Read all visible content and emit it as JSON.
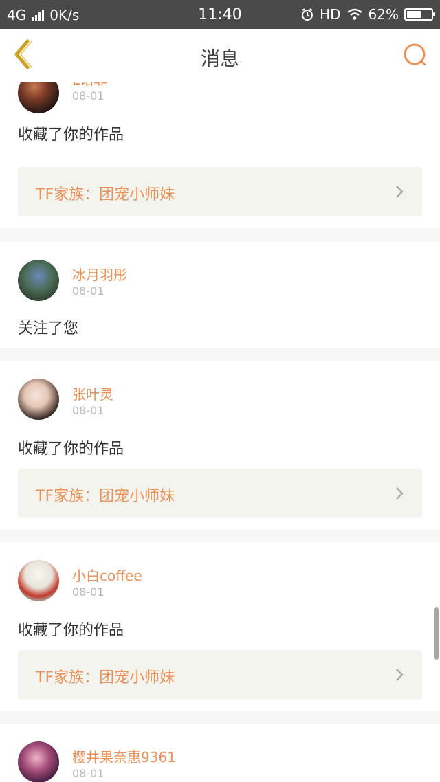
{
  "status": {
    "network": "4G",
    "speed": "0K/s",
    "time": "11:40",
    "hd": "HD",
    "battery": "62%",
    "battery_level": 0.62
  },
  "nav": {
    "title": "消息",
    "back_icon": "chevron-left-icon",
    "search_icon": "search-icon",
    "accent": "#e9925a"
  },
  "messages": [
    {
      "name": "L诺菲",
      "date": "08-01",
      "action": "收藏了你的作品",
      "work": "TF家族：团宠小师妹"
    },
    {
      "name": "冰月羽彤",
      "date": "08-01",
      "action": "关注了您"
    },
    {
      "name": "张叶灵",
      "date": "08-01",
      "action": "收藏了你的作品",
      "work": "TF家族：团宠小师妹"
    },
    {
      "name": "小白coffee",
      "date": "08-01",
      "action": "收藏了你的作品",
      "work": "TF家族：团宠小师妹"
    },
    {
      "name": "樱井果奈惠9361",
      "date": "08-01"
    }
  ]
}
